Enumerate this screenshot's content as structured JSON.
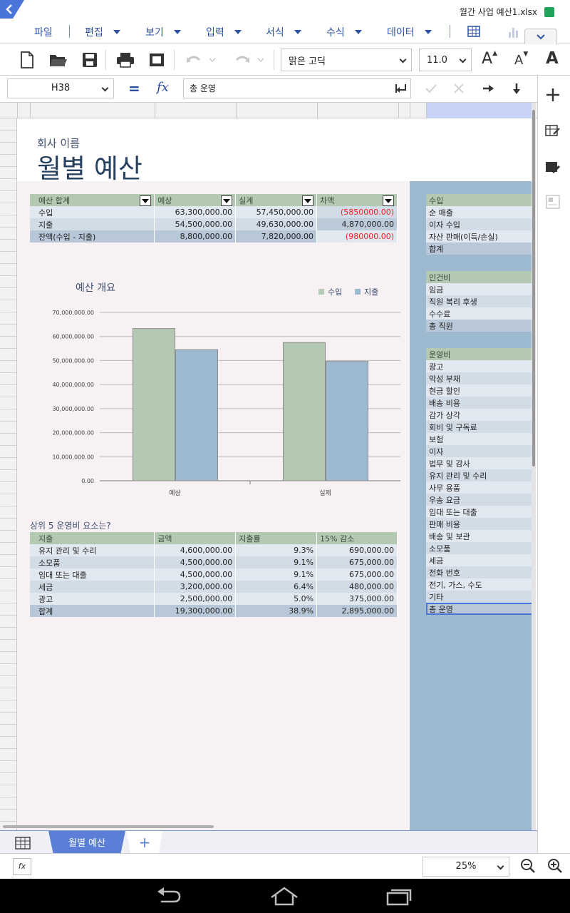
{
  "window": {
    "file_name": "월간 사업 예산1.xlsx"
  },
  "menu": {
    "items": [
      {
        "label": "파일",
        "has_caret": false
      },
      {
        "label": "편집",
        "has_caret": true
      },
      {
        "label": "보기",
        "has_caret": true
      },
      {
        "label": "입력",
        "has_caret": true
      },
      {
        "label": "서식",
        "has_caret": true
      },
      {
        "label": "수식",
        "has_caret": true
      },
      {
        "label": "데이터",
        "has_caret": true
      }
    ]
  },
  "toolbar": {
    "font_name": "맑은 고딕",
    "font_size": "11.0",
    "grow_font_glyph": "A",
    "shrink_font_glyph": "A",
    "format_glyph": "A"
  },
  "formula_bar": {
    "cell_ref": "H38",
    "equals": "=",
    "fx": "fx",
    "content": "총 운영"
  },
  "sheet": {
    "company_name": "회사 이름",
    "title": "월별 예산",
    "summary_table": {
      "headers": [
        "예산 합계",
        "예상",
        "실계",
        "차액"
      ],
      "rows": [
        {
          "label": "수입",
          "expected": "63,300,000.00",
          "actual": "57,450,000.00",
          "diff": "(5850000.00)",
          "diff_negative": true
        },
        {
          "label": "지출",
          "expected": "54,500,000.00",
          "actual": "49,630,000.00",
          "diff": "4,870,000.00",
          "diff_negative": false
        },
        {
          "label": "잔액(수입 - 지출)",
          "expected": "8,800,000.00",
          "actual": "7,820,000.00",
          "diff": "(980000.00)",
          "diff_negative": true
        }
      ]
    },
    "top5_title": "상위 5 운영비 요소는?",
    "top5_table": {
      "headers": [
        "지출",
        "금액",
        "지출률",
        "15% 감소"
      ],
      "rows": [
        [
          "유지 관리 및 수리",
          "4,600,000.00",
          "9.3%",
          "690,000.00"
        ],
        [
          "소모품",
          "4,500,000.00",
          "9.1%",
          "675,000.00"
        ],
        [
          "임대 또는 대출",
          "4,500,000.00",
          "9.1%",
          "675,000.00"
        ],
        [
          "세금",
          "3,200,000.00",
          "6.4%",
          "480,000.00"
        ],
        [
          "광고",
          "2,500,000.00",
          "5.0%",
          "375,000.00"
        ]
      ],
      "total": [
        "합계",
        "19,300,000.00",
        "38.9%",
        "2,895,000.00"
      ]
    },
    "income_panel": {
      "header": "수입",
      "items": [
        "순 매출",
        "이자 수입",
        "자산 판매(이득/손실)"
      ],
      "total": "합계"
    },
    "personnel_panel": {
      "header": "인건비",
      "items": [
        "임금",
        "직원 복리 후생",
        "수수료"
      ],
      "total": "총 직원"
    },
    "operating_panel": {
      "header": "운영비",
      "items": [
        "광고",
        "악성 부채",
        "현금 할인",
        "배송 비용",
        "감가 상각",
        "회비 및 구독료",
        "보험",
        "이자",
        "법무 및 감사",
        "유지 관리 및 수리",
        "사무 용품",
        "우송 요금",
        "임대 또는 대출",
        "판매 비용",
        "배송 및 보관",
        "소모품",
        "세금",
        "전화 번호",
        "전기, 가스, 수도",
        "기타"
      ],
      "total": "총 운영"
    }
  },
  "chart_data": {
    "type": "bar",
    "title": "예산 개요",
    "categories": [
      "예상",
      "실제"
    ],
    "series": [
      {
        "name": "수입",
        "color": "#b3c9b2",
        "values": [
          63300000,
          57450000
        ]
      },
      {
        "name": "지출",
        "color": "#9db9cf",
        "values": [
          54500000,
          49630000
        ]
      }
    ],
    "ylim": [
      0,
      70000000
    ],
    "yticks": [
      "0.00",
      "10,000,000.00",
      "20,000,000.00",
      "30,000,000.00",
      "40,000,000.00",
      "50,000,000.00",
      "60,000,000.00",
      "70,000,000.00"
    ],
    "legend": "top-right",
    "grid": true
  },
  "tabs": {
    "active_sheet": "월별 예산",
    "add_label": "+"
  },
  "status": {
    "fx_label": "fx",
    "zoom": "25%"
  },
  "colors": {
    "accent": "#2b4fa3",
    "tab_active": "#5b7fd6",
    "negative": "#e22222"
  }
}
